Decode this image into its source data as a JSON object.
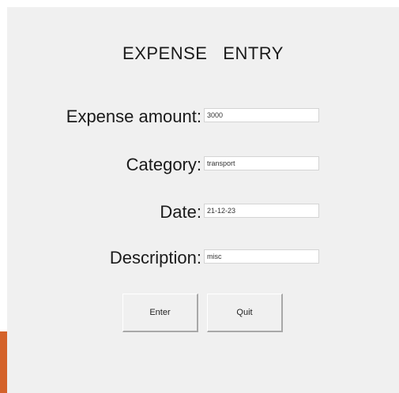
{
  "form": {
    "title": "EXPENSE   ENTRY",
    "fields": [
      {
        "label": "Expense amount:",
        "value": "3000"
      },
      {
        "label": "Category:",
        "value": "transport"
      },
      {
        "label": "Date:",
        "value": "21-12-23"
      },
      {
        "label": "Description:",
        "value": "misc"
      }
    ],
    "buttons": {
      "enter": "Enter",
      "quit": "Quit"
    }
  },
  "colors": {
    "window_background": "#f0f0f0",
    "accent": "#d4622a"
  }
}
